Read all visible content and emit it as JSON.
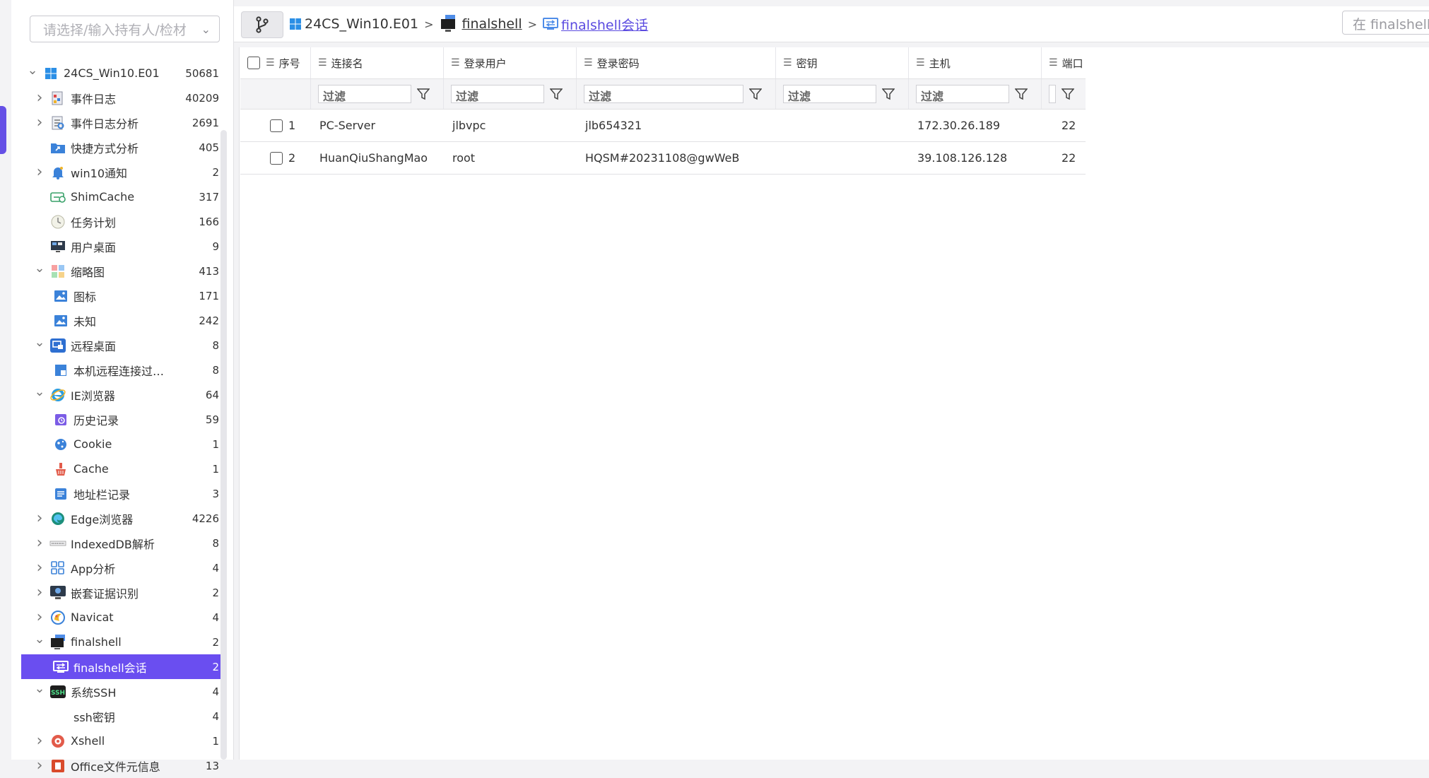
{
  "sidebar": {
    "owner_placeholder": "请选择/输入持有人/检材",
    "tree": [
      {
        "label": "24CS_Win10.E01",
        "count": "50681",
        "level": 0,
        "toggle": "down",
        "icon": "windows-icon"
      },
      {
        "label": "事件日志",
        "count": "40209",
        "level": 1,
        "toggle": "right",
        "icon": "event-log-icon"
      },
      {
        "label": "事件日志分析",
        "count": "2691",
        "level": 1,
        "toggle": "right",
        "icon": "log-analysis-icon"
      },
      {
        "label": "快捷方式分析",
        "count": "405",
        "level": 1,
        "toggle": "",
        "icon": "shortcut-folder-icon"
      },
      {
        "label": "win10通知",
        "count": "2",
        "level": 1,
        "toggle": "right",
        "icon": "bell-icon"
      },
      {
        "label": "ShimCache",
        "count": "317",
        "level": 1,
        "toggle": "",
        "icon": "shimcache-icon"
      },
      {
        "label": "任务计划",
        "count": "166",
        "level": 1,
        "toggle": "",
        "icon": "clock-icon"
      },
      {
        "label": "用户桌面",
        "count": "9",
        "level": 1,
        "toggle": "",
        "icon": "desktop-icon"
      },
      {
        "label": "缩略图",
        "count": "413",
        "level": 1,
        "toggle": "down",
        "icon": "thumbnail-icon"
      },
      {
        "label": "图标",
        "count": "171",
        "level": 2,
        "toggle": "",
        "icon": "image-icon"
      },
      {
        "label": "未知",
        "count": "242",
        "level": 2,
        "toggle": "",
        "icon": "image-icon"
      },
      {
        "label": "远程桌面",
        "count": "8",
        "level": 1,
        "toggle": "down",
        "icon": "remote-desktop-icon"
      },
      {
        "label": "本机远程连接过…",
        "count": "8",
        "level": 2,
        "toggle": "",
        "icon": "remote-connection-icon"
      },
      {
        "label": "IE浏览器",
        "count": "64",
        "level": 1,
        "toggle": "down",
        "icon": "ie-browser-icon"
      },
      {
        "label": "历史记录",
        "count": "59",
        "level": 2,
        "toggle": "",
        "icon": "history-icon"
      },
      {
        "label": "Cookie",
        "count": "1",
        "level": 2,
        "toggle": "",
        "icon": "cookie-icon"
      },
      {
        "label": "Cache",
        "count": "1",
        "level": 2,
        "toggle": "",
        "icon": "cache-icon"
      },
      {
        "label": "地址栏记录",
        "count": "3",
        "level": 2,
        "toggle": "",
        "icon": "address-bar-icon"
      },
      {
        "label": "Edge浏览器",
        "count": "4226",
        "level": 1,
        "toggle": "right",
        "icon": "edge-browser-icon"
      },
      {
        "label": "IndexedDB解析",
        "count": "8",
        "level": 1,
        "toggle": "right",
        "icon": "indexeddb-icon"
      },
      {
        "label": "App分析",
        "count": "4",
        "level": 1,
        "toggle": "right",
        "icon": "app-grid-icon"
      },
      {
        "label": "嵌套证据识别",
        "count": "2",
        "level": 1,
        "toggle": "right",
        "icon": "monitor-icon"
      },
      {
        "label": "Navicat",
        "count": "4",
        "level": 1,
        "toggle": "right",
        "icon": "navicat-icon"
      },
      {
        "label": "finalshell",
        "count": "2",
        "level": 1,
        "toggle": "down",
        "icon": "finalshell-icon"
      },
      {
        "label": "finalshell会话",
        "count": "2",
        "level": 2,
        "toggle": "",
        "icon": "session-icon",
        "selected": true
      },
      {
        "label": "系统SSH",
        "count": "4",
        "level": 1,
        "toggle": "down",
        "icon": "ssh-icon"
      },
      {
        "label": "ssh密钥",
        "count": "4",
        "level": 2,
        "toggle": "",
        "icon": ""
      },
      {
        "label": "Xshell",
        "count": "1",
        "level": 1,
        "toggle": "right",
        "icon": "xshell-icon"
      },
      {
        "label": "Office文件元信息",
        "count": "13",
        "level": 1,
        "toggle": "right",
        "icon": "office-icon"
      }
    ]
  },
  "breadcrumb": {
    "items": [
      {
        "label": "24CS_Win10.E01",
        "icon": "windows-icon"
      },
      {
        "label": "finalshell",
        "icon": "finalshell-icon"
      },
      {
        "label": "finalshell会话",
        "icon": "session-icon"
      }
    ],
    "separator": ">"
  },
  "search": {
    "placeholder": "在 finalshell会话中搜索"
  },
  "table": {
    "columns": [
      "序号",
      "连接名",
      "登录用户",
      "登录密码",
      "密钥",
      "主机",
      "端口"
    ],
    "filter_placeholder": "过滤",
    "rows": [
      {
        "index": "1",
        "name": "PC-Server",
        "user": "jlbvpc",
        "password": "jlb654321",
        "key": "",
        "host": "172.30.26.189",
        "port": "22"
      },
      {
        "index": "2",
        "name": "HuanQiuShangMao",
        "user": "root",
        "password": "HQSM#20231108@gwWeB",
        "key": "",
        "host": "39.108.126.128",
        "port": "22"
      }
    ]
  },
  "colors": {
    "accent": "#6a4ef0",
    "link": "#5b4be0"
  }
}
